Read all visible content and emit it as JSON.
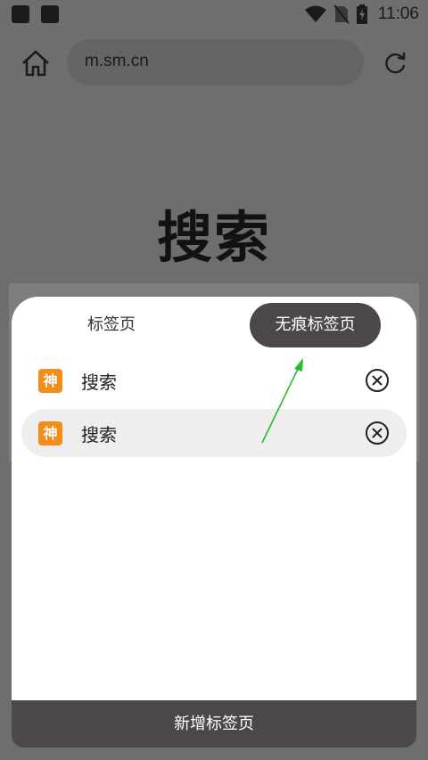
{
  "status_bar": {
    "time": "11:06"
  },
  "browser": {
    "url": "m.sm.cn"
  },
  "page": {
    "title": "搜索"
  },
  "tab_panel": {
    "tabs": [
      {
        "label": "标签页"
      },
      {
        "label": "无痕标签页"
      }
    ],
    "open_tabs": [
      {
        "favicon_text": "神",
        "title": "搜索"
      },
      {
        "favicon_text": "神",
        "title": "搜索"
      }
    ],
    "new_tab_label": "新增标签页"
  },
  "colors": {
    "accent_dark": "#4d4848",
    "favicon_orange": "#f28c1c",
    "annotation_arrow": "#22c02a"
  }
}
